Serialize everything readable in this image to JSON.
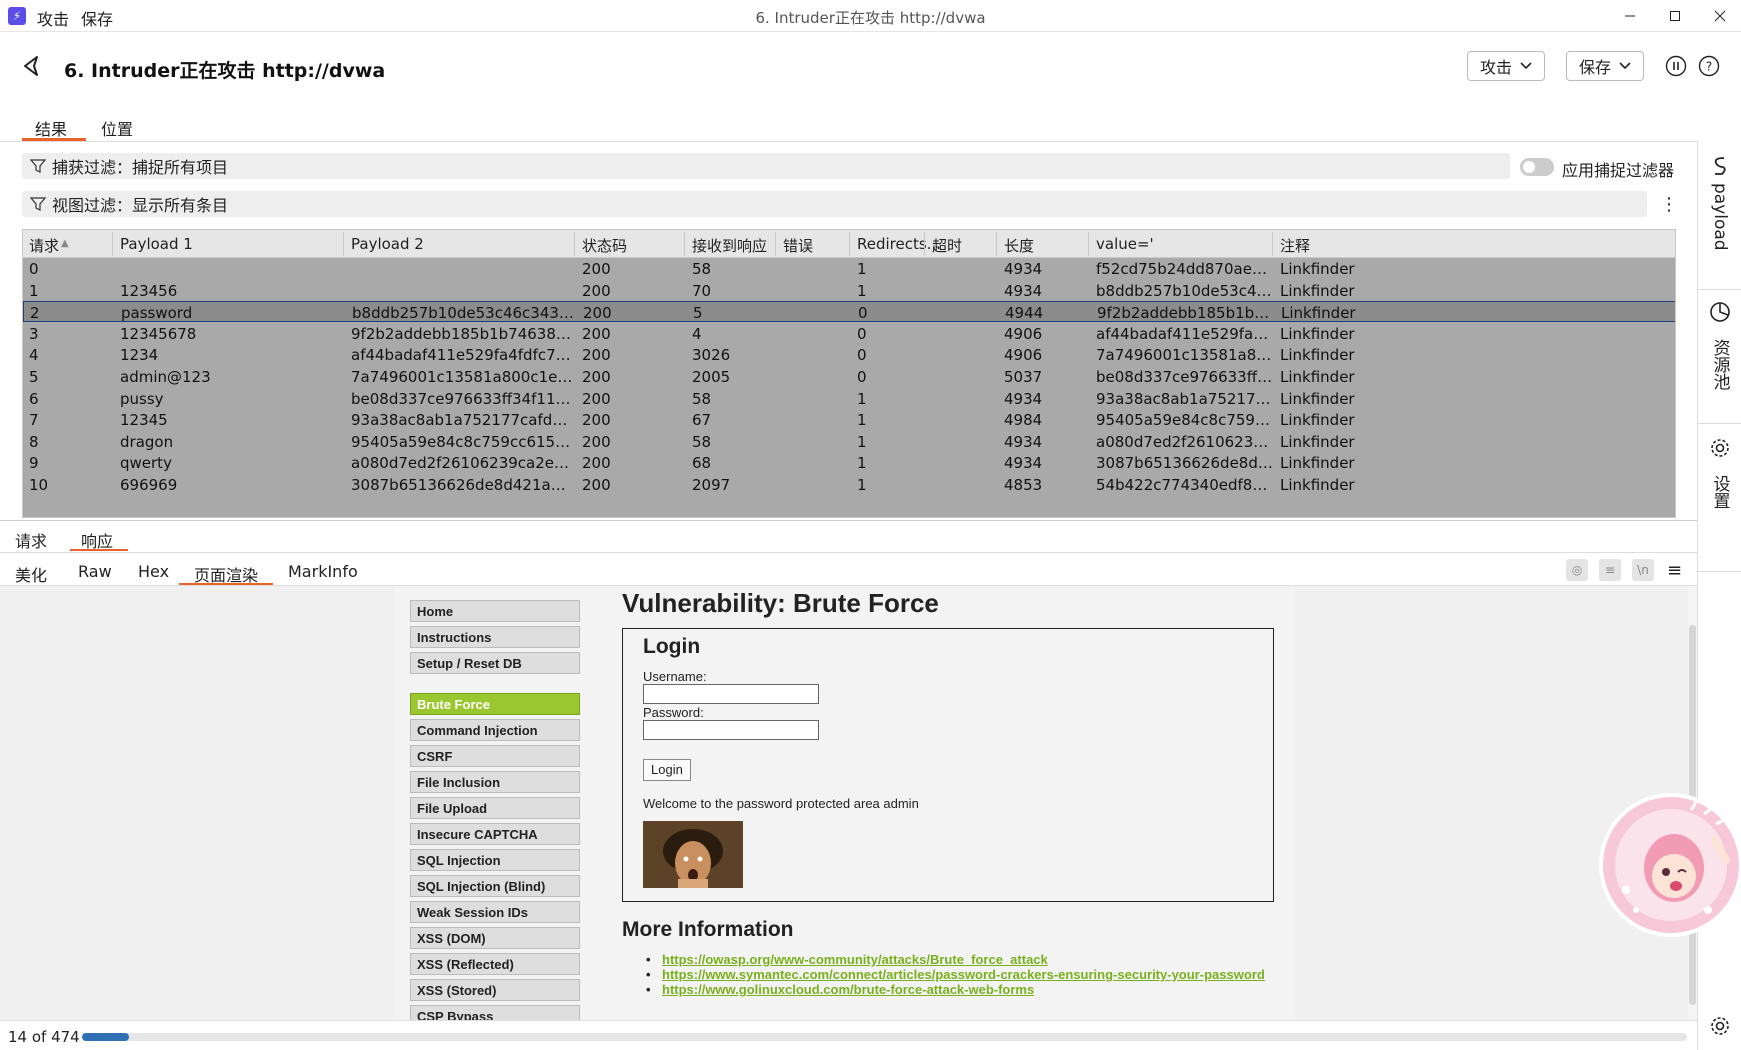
{
  "titlebar": {
    "menu": [
      "攻击",
      "保存"
    ],
    "window_title": "6. Intruder正在攻击 http://dvwa"
  },
  "header": {
    "title": "6. Intruder正在攻击 http://dvwa",
    "attack_label": "攻击",
    "save_label": "保存"
  },
  "main_tabs": [
    "结果",
    "位置"
  ],
  "filters": {
    "capture": "捕获过滤：捕捉所有项目",
    "view": "视图过滤：显示所有条目",
    "toggle_label": "应用捕捉过滤器",
    "toggle_on": false
  },
  "right_sidebar": [
    "payload",
    "资源池",
    "设置"
  ],
  "table": {
    "headers": [
      "请求",
      "Payload 1",
      "Payload 2",
      "状态码",
      "接收到响应",
      "错误",
      "Redirects...",
      "超时",
      "长度",
      "value='",
      "注释"
    ],
    "rows": [
      [
        "0",
        "",
        "",
        "200",
        "58",
        "",
        "1",
        "",
        "4934",
        "f52cd75b24dd870ae3b15...",
        "Linkfinder"
      ],
      [
        "1",
        "123456",
        "",
        "200",
        "70",
        "",
        "1",
        "",
        "4934",
        "b8ddb257b10de53c46c34...",
        "Linkfinder"
      ],
      [
        "2",
        "password",
        "b8ddb257b10de53c46c34378eb3...",
        "200",
        "5",
        "",
        "0",
        "",
        "4944",
        "9f2b2addebb185b1b7463...",
        "Linkfinder"
      ],
      [
        "3",
        "12345678",
        "9f2b2addebb185b1b746389a41fa...",
        "200",
        "4",
        "",
        "0",
        "",
        "4906",
        "af44badaf411e529fa4fdfc7...",
        "Linkfinder"
      ],
      [
        "4",
        "1234",
        "af44badaf411e529fa4fdfc725291...",
        "200",
        "3026",
        "",
        "0",
        "",
        "4906",
        "7a7496001c13581a800c1...",
        "Linkfinder"
      ],
      [
        "5",
        "admin@123",
        "7a7496001c13581a800c1ee5e99f...",
        "200",
        "2005",
        "",
        "0",
        "",
        "5037",
        "be08d337ce976633ff34f1...",
        "Linkfinder"
      ],
      [
        "6",
        "pussy",
        "be08d337ce976633ff34f1190872...",
        "200",
        "58",
        "",
        "1",
        "",
        "4934",
        "93a38ac8ab1a752177cafd...",
        "Linkfinder"
      ],
      [
        "7",
        "12345",
        "93a38ac8ab1a752177cafd3d8cab...",
        "200",
        "67",
        "",
        "1",
        "",
        "4984",
        "95405a59e84c8c759cc615...",
        "Linkfinder"
      ],
      [
        "8",
        "dragon",
        "95405a59e84c8c759cc615fca60f1...",
        "200",
        "58",
        "",
        "1",
        "",
        "4934",
        "a080d7ed2f26106239ca2e...",
        "Linkfinder"
      ],
      [
        "9",
        "qwerty",
        "a080d7ed2f26106239ca2e2395ce...",
        "200",
        "68",
        "",
        "1",
        "",
        "4934",
        "3087b65136626de8d421a...",
        "Linkfinder"
      ],
      [
        "10",
        "696969",
        "3087b65136626de8d421a576cb1...",
        "200",
        "2097",
        "",
        "1",
        "",
        "4853",
        "54b422c774340edf88e68f...",
        "Linkfinder"
      ]
    ],
    "selected_index": 2
  },
  "bottom_tabs": [
    "请求",
    "响应"
  ],
  "view_tabs": [
    "美化",
    "Raw",
    "Hex",
    "页面渲染",
    "MarkInfo"
  ],
  "dvwa": {
    "menu": [
      "Home",
      "Instructions",
      "Setup / Reset DB",
      "Brute Force",
      "Command Injection",
      "CSRF",
      "File Inclusion",
      "File Upload",
      "Insecure CAPTCHA",
      "SQL Injection",
      "SQL Injection (Blind)",
      "Weak Session IDs",
      "XSS (DOM)",
      "XSS (Reflected)",
      "XSS (Stored)",
      "CSP Bypass"
    ],
    "active_item": "Brute Force",
    "vuln_title": "Vulnerability: Brute Force",
    "login_heading": "Login",
    "username_label": "Username:",
    "password_label": "Password:",
    "login_button": "Login",
    "welcome": "Welcome to the password protected area admin",
    "more_info": "More Information",
    "links": [
      "https://owasp.org/www-community/attacks/Brute_force_attack",
      "https://www.symantec.com/connect/articles/password-crackers-ensuring-security-your-password",
      "https://www.golinuxcloud.com/brute-force-attack-web-forms"
    ]
  },
  "status": {
    "text": "14 of 474",
    "progress": 0.0295
  },
  "colors": {
    "accent": "#e8622a",
    "dvwa_active": "#9ac72f",
    "link": "#7ab01d",
    "progress": "#2f6fb3"
  }
}
